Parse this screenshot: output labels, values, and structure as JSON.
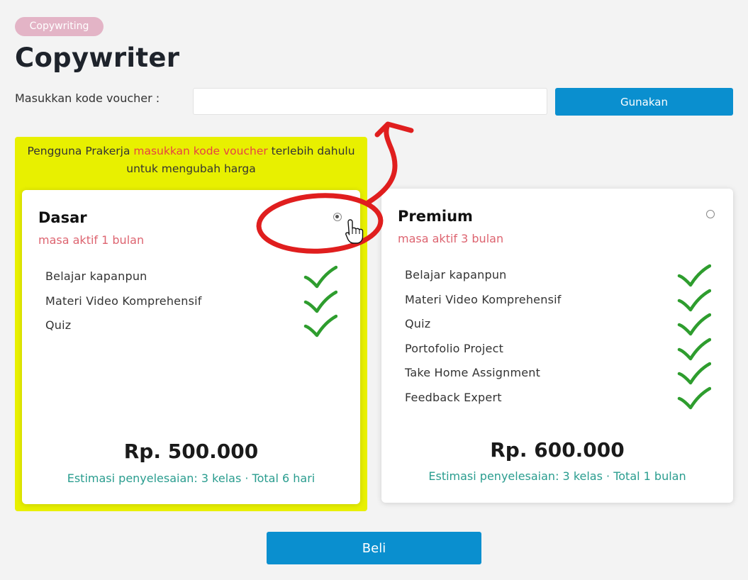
{
  "category_badge": "Copywriting",
  "title": "Copywriter",
  "voucher": {
    "label": "Masukkan kode voucher :",
    "value": "",
    "placeholder": "",
    "button": "Gunakan"
  },
  "notice": {
    "before": "Pengguna Prakerja ",
    "highlight": "masukkan kode voucher",
    "after": " terlebih dahulu untuk mengubah harga"
  },
  "plans": [
    {
      "name": "Dasar",
      "duration": "masa aktif 1 bulan",
      "selected": true,
      "features": [
        "Belajar kapanpun",
        "Materi Video Komprehensif",
        "Quiz"
      ],
      "price": "Rp. 500.000",
      "estimate": "Estimasi penyelesaian: 3 kelas · Total 6 hari"
    },
    {
      "name": "Premium",
      "duration": "masa aktif 3 bulan",
      "selected": false,
      "features": [
        "Belajar kapanpun",
        "Materi Video Komprehensif",
        "Quiz",
        "Portofolio Project",
        "Take Home Assignment",
        "Feedback Expert"
      ],
      "price": "Rp. 600.000",
      "estimate": "Estimasi penyelesaian: 3 kelas · Total 1 bulan"
    }
  ],
  "buy_button": "Beli",
  "icons": {
    "check": "check-icon",
    "cursor": "hand-pointer-icon"
  },
  "colors": {
    "primary": "#0a8fcf",
    "highlight_box": "#e8f000",
    "badge": "#e3b4c6",
    "duration": "#dd6470",
    "estimate": "#2a9d8f",
    "check": "#2e9d2e",
    "annotation": "#e01e1e",
    "notice_highlight": "#e64343"
  }
}
